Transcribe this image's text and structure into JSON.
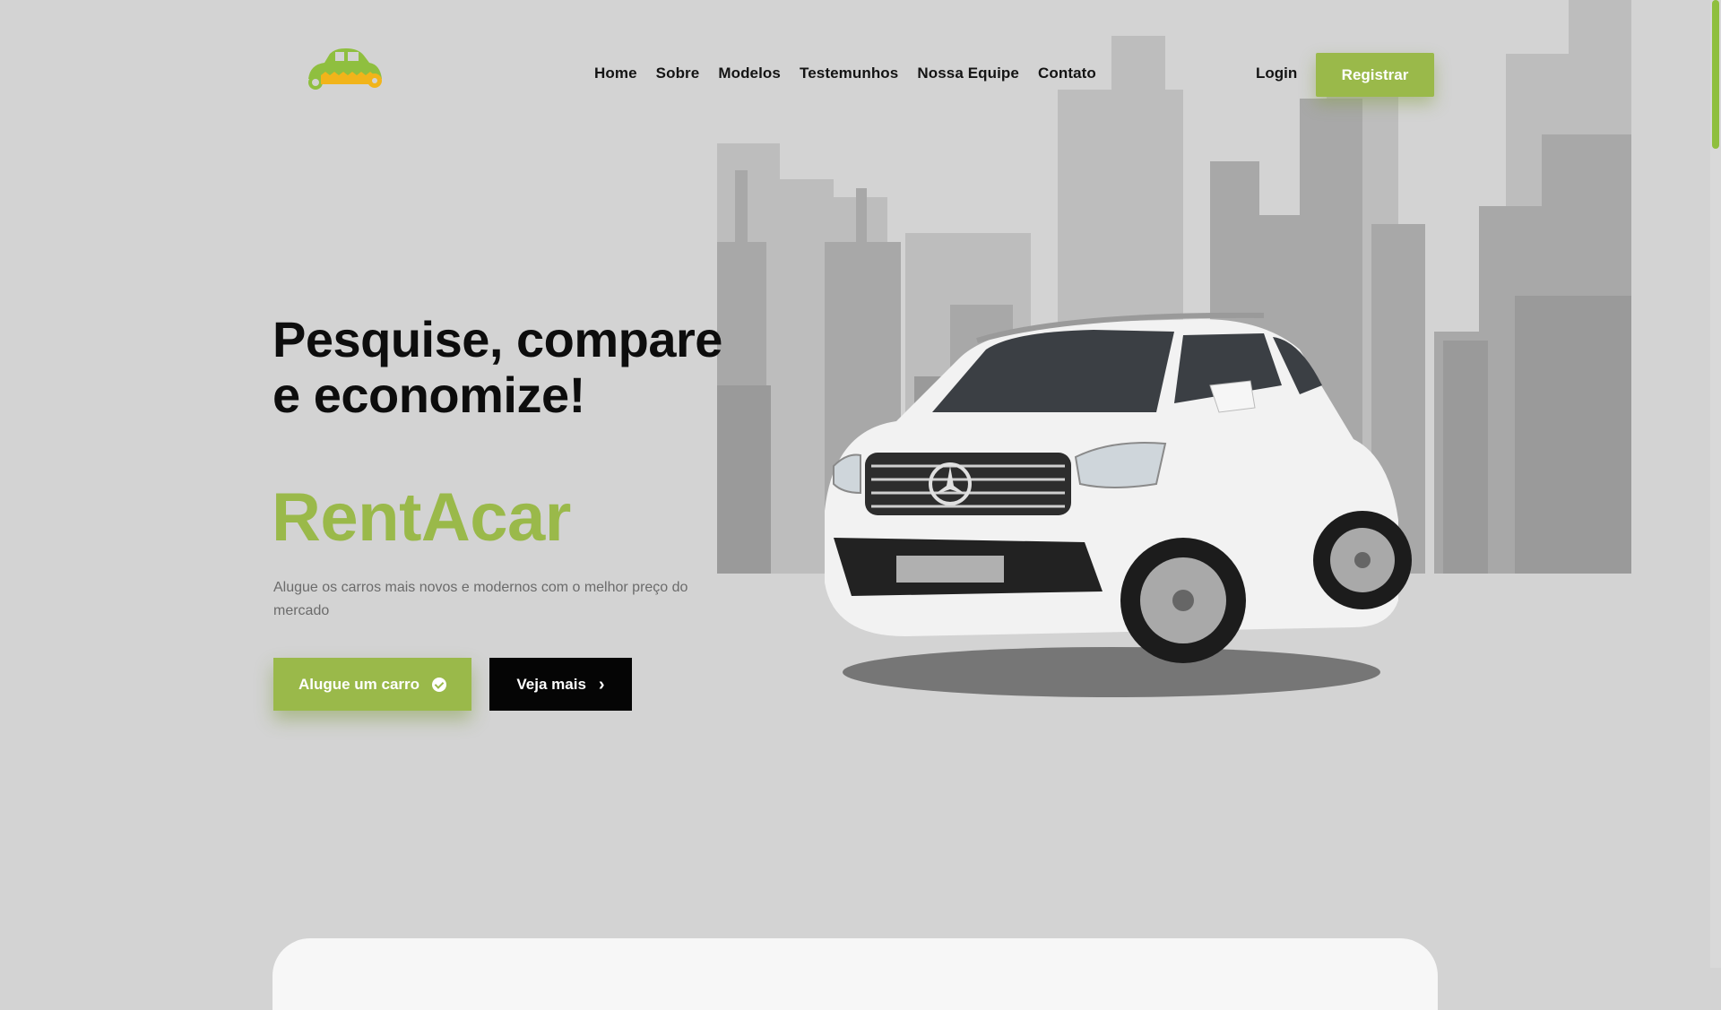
{
  "header": {
    "logo_icon": "car-key-icon",
    "nav": [
      "Home",
      "Sobre",
      "Modelos",
      "Testemunhos",
      "Nossa Equipe",
      "Contato"
    ],
    "login_label": "Login",
    "register_label": "Registrar"
  },
  "hero": {
    "title": "Pesquise, compare e economize!",
    "brand": "RentAcar",
    "subtitle": "Alugue os carros mais novos e modernos com o melhor preço do mercado",
    "rent_button": "Alugue um carro",
    "rent_button_icon": "check-circle-icon",
    "more_button": "Veja mais",
    "more_button_icon": "chevron-right-icon"
  },
  "colors": {
    "accent": "#9ab94a",
    "background": "#d3d3d3",
    "dark_button": "#050505"
  }
}
